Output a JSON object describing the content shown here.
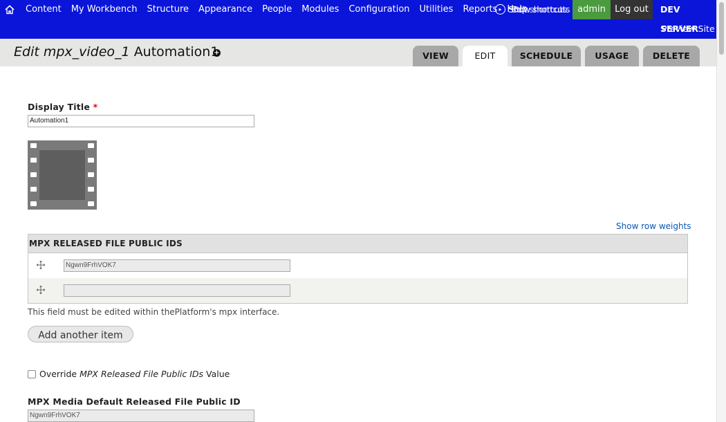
{
  "toolbar": {
    "menu": [
      "Content",
      "My Workbench",
      "Structure",
      "Appearance",
      "People",
      "Modules",
      "Configuration",
      "Utilities",
      "Reports",
      "Help"
    ],
    "shortcuts_toggle_label": "Show shortcuts",
    "shortcuts_overlap_label": "Edit shortcuts",
    "admin_label": "admin",
    "logout_label": "Log out",
    "server_label": "DEV SERVER",
    "preview_label": "Preview Site",
    "background_color": "#0a15d9",
    "admin_color": "#4a9a3e"
  },
  "title": {
    "prefix": "Edit mpx_video_1",
    "name": "Automation1",
    "add_shortcut_symbol": "+"
  },
  "tabs": [
    {
      "label": "VIEW",
      "active": false
    },
    {
      "label": "EDIT",
      "active": true
    },
    {
      "label": "SCHEDULE",
      "active": false
    },
    {
      "label": "USAGE",
      "active": false
    },
    {
      "label": "DELETE",
      "active": false
    }
  ],
  "form": {
    "display_title_label": "Display Title",
    "required_mark": "*",
    "display_title_value": "Automation1",
    "thumbnail_icon": "film-icon",
    "show_row_weights": "Show row weights",
    "table_header": "MPX RELEASED FILE PUBLIC IDS",
    "rows": [
      {
        "value": "Ngwn9FrhVOK7"
      },
      {
        "value": ""
      }
    ],
    "field_description": "This field must be edited within thePlatform's mpx interface.",
    "add_another_label": "Add another item",
    "override_prefix": "Override",
    "override_field": "MPX Released File Public IDs",
    "override_suffix": "Value",
    "override_checked": false,
    "default_label": "MPX Media Default Released File Public ID",
    "default_value": "Ngwn9FrhVOK7"
  }
}
